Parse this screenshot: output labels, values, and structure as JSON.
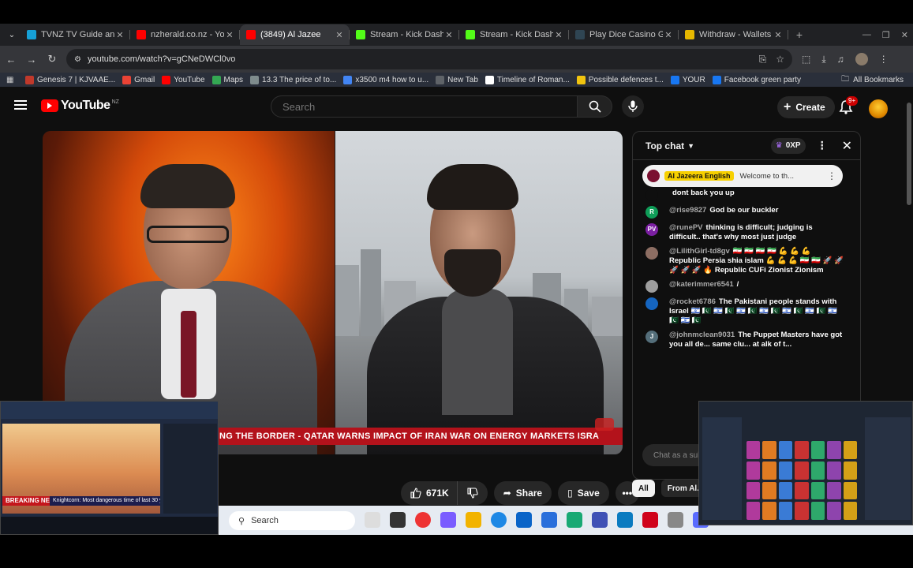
{
  "browser": {
    "tabs": [
      {
        "label": "TVNZ TV Guide and Fr",
        "icon": "tvnz-icon",
        "color": "#16a0d6",
        "active": false
      },
      {
        "label": "nzherald.co.nz - YouTu",
        "icon": "youtube-icon",
        "color": "#ff0000",
        "active": false
      },
      {
        "label": "(3849) Al Jazee",
        "icon": "youtube-icon",
        "color": "#ff0000",
        "active": true
      },
      {
        "label": "Stream - Kick Dashbo",
        "icon": "kick-icon",
        "color": "#53fc18",
        "active": false
      },
      {
        "label": "Stream - Kick Dashbo",
        "icon": "kick-icon",
        "color": "#53fc18",
        "active": false
      },
      {
        "label": "Play Dice Casino Gam",
        "icon": "stake-icon",
        "color": "#2f4553",
        "active": false
      },
      {
        "label": "Withdraw - Wallets - ",
        "icon": "wallet-icon",
        "color": "#e6b800",
        "active": false
      }
    ],
    "url": "youtube.com/watch?v=gCNeDWCl0vo",
    "bookmarks": [
      {
        "label": "Genesis 7 | KJVAAE...",
        "color": "#c0392b"
      },
      {
        "label": "Gmail",
        "color": "#ea4335"
      },
      {
        "label": "YouTube",
        "color": "#ff0000"
      },
      {
        "label": "Maps",
        "color": "#34a853"
      },
      {
        "label": "13.3 The price of to...",
        "color": "#7f8c8d"
      },
      {
        "label": "x3500 m4 how to u...",
        "color": "#4285f4"
      },
      {
        "label": "New Tab",
        "color": "#5f6368"
      },
      {
        "label": "Timeline of Roman...",
        "color": "#ffffff"
      },
      {
        "label": "Possible defences t...",
        "color": "#f1c40f"
      },
      {
        "label": "YOUR",
        "color": "#1877f2"
      },
      {
        "label": "Facebook green party",
        "color": "#1877f2"
      }
    ],
    "all_bookmarks": "All Bookmarks"
  },
  "youtube": {
    "logo": "YouTube",
    "region": "NZ",
    "search_placeholder": "Search",
    "create_label": "Create",
    "notifications_badge": "9+",
    "ticker_text": "NG THE BORDER  -  QATAR WARNS IMPACT OF IRAN WAR ON ENERGY MARKETS  ISRA",
    "likes": "671K",
    "share_label": "Share",
    "save_label": "Save",
    "chat": {
      "title": "Top chat",
      "xp": "0XP",
      "pinned_channel": "Al Jazeera English",
      "pinned_text": "Welcome to th...",
      "messages": [
        {
          "author": "",
          "avatar": "",
          "color": "#0f0f0f",
          "text": "dont back you up"
        },
        {
          "author": "@rise9827",
          "avatar": "R",
          "color": "#0f9d58",
          "text": "God be our buckler"
        },
        {
          "author": "@runePV",
          "avatar": "PV",
          "color": "#7b1fa2",
          "text": "thinking is difficult; judging is difficult.. that's why most just judge"
        },
        {
          "author": "@LilithGirl-td8gv",
          "avatar": "",
          "color": "#8d6e63",
          "text": "🇮🇷 🇮🇷 🇮🇷 🇮🇷 💪 💪 💪 Republic Persia shia islam 💪 💪 💪 🇮🇷 🇮🇷 🚀 🚀 🚀 🚀 🚀 🔥 Republic CUFi Zionist Zionism"
        },
        {
          "author": "@katerimmer6541",
          "avatar": "",
          "color": "#9e9e9e",
          "text": "/"
        },
        {
          "author": "@rocket6786",
          "avatar": "",
          "color": "#1565c0",
          "text": "The Pakistani people stands with Israel 🇮🇱 🇵🇰 🇮🇱 🇵🇰 🇮🇱 🇵🇰 🇮🇱 🇵🇰 🇮🇱 🇵🇰 🇮🇱 🇵🇰 🇮🇱 🇵🇰 🇮🇱 🇵🇰"
        },
        {
          "author": "@johnmclean9031",
          "avatar": "J",
          "color": "#546e7a",
          "text": "The Puppet Masters have got you all de... same clu... at alk of t..."
        }
      ],
      "input_placeholder": "Chat as a subscriber...",
      "chips": [
        "All",
        "From Al..."
      ]
    }
  },
  "taskbar": {
    "search_placeholder": "Search"
  },
  "pip": {
    "breaking_label": "BREAKING NEWS",
    "breaking_text": "Knightcorn: Most dangerous time of last 30 years"
  }
}
